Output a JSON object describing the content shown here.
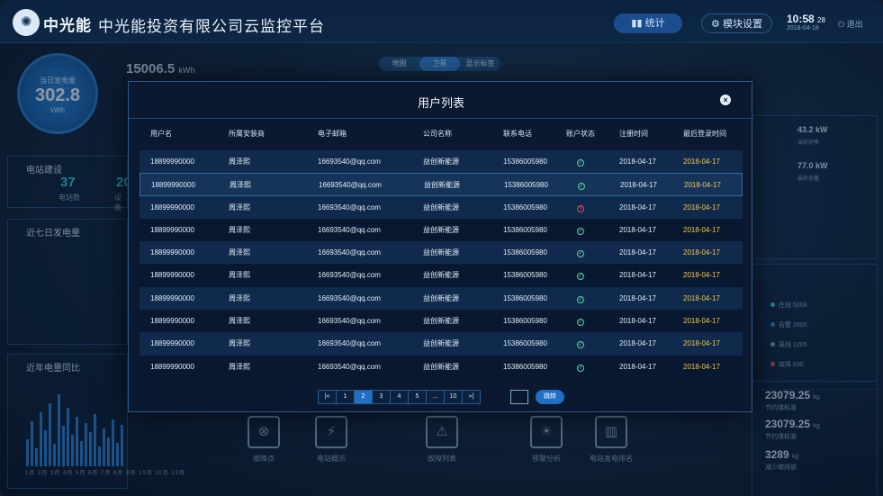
{
  "header": {
    "brand": "中光能",
    "company": "中光能投资有限公司云监控平台",
    "stats_label": "统计",
    "modules_label": "模块设置",
    "time": "10:58",
    "seconds": "28",
    "date": "2018-04-18",
    "logout_label": "退出"
  },
  "background": {
    "gauge_title": "当日发电量",
    "gauge_value": "302.8",
    "gauge_unit": "kWh",
    "total_kwh": "15006.5",
    "total_unit": "kWh",
    "station_title": "电站建设",
    "station_count": "37",
    "station_count_label": "电站数",
    "device_count": "20",
    "device_label": "设备",
    "week_title": "近七日发电量",
    "year_title": "近年电量同比",
    "months": "1月 2月 3月 4月 5月 6月 7月 8月 9月 10月 11月 12月",
    "map_tabs": [
      "地图",
      "卫星",
      "显示标签"
    ],
    "right_power": "43.2",
    "right_power_unit": "kW",
    "right_power_label": "当前功率",
    "right_capacity": "77.0",
    "right_capacity_unit": "kW",
    "right_capacity_label": "装机容量",
    "legend": [
      {
        "label": "在线",
        "value": "5008",
        "color": "#3ad0e0"
      },
      {
        "label": "告警",
        "value": "2600",
        "color": "#2a86d8"
      },
      {
        "label": "离线",
        "value": "1205",
        "color": "#7fa3c8"
      },
      {
        "label": "故障",
        "value": "630",
        "color": "#e2504f"
      }
    ],
    "saving1": "23079.25",
    "saving1_unit": "kg",
    "saving1_label": "节约煤标准",
    "saving2": "23079.25",
    "saving2_unit": "kg",
    "saving2_label": "节约煤标准",
    "saving3": "3289",
    "saving3_unit": "kg",
    "saving3_label": "减少碳排放",
    "tiles": [
      "故障点",
      "电站概示",
      "故障列表",
      "预警分析",
      "电站发电排名"
    ]
  },
  "modal": {
    "title": "用户列表",
    "close_symbol": "×",
    "columns": [
      "用户名",
      "所属安装商",
      "电子邮箱",
      "公司名称",
      "联系电话",
      "账户状态",
      "注册时间",
      "最后登录时间"
    ],
    "rows": [
      {
        "username": "18899990000",
        "installer": "周泽熙",
        "email": "16693540@qq.com",
        "company": "益创新能源",
        "phone": "15386005980",
        "status": "ok",
        "registered": "2018-04-17",
        "last_login": "2018-04-17"
      },
      {
        "username": "18899990000",
        "installer": "周泽熙",
        "email": "16693540@qq.com",
        "company": "益创新能源",
        "phone": "15386005980",
        "status": "ok",
        "registered": "2018-04-17",
        "last_login": "2018-04-17"
      },
      {
        "username": "18899990000",
        "installer": "周泽熙",
        "email": "16693540@qq.com",
        "company": "益创新能源",
        "phone": "15386005980",
        "status": "disabled",
        "registered": "2018-04-17",
        "last_login": "2018-04-17"
      },
      {
        "username": "18899990000",
        "installer": "周泽熙",
        "email": "16693540@qq.com",
        "company": "益创新能源",
        "phone": "15386005980",
        "status": "ok",
        "registered": "2018-04-17",
        "last_login": "2018-04-17"
      },
      {
        "username": "18899990000",
        "installer": "周泽熙",
        "email": "16693540@qq.com",
        "company": "益创新能源",
        "phone": "15386005980",
        "status": "ok",
        "registered": "2018-04-17",
        "last_login": "2018-04-17"
      },
      {
        "username": "18899990000",
        "installer": "周泽熙",
        "email": "16693540@qq.com",
        "company": "益创新能源",
        "phone": "15386005980",
        "status": "ok",
        "registered": "2018-04-17",
        "last_login": "2018-04-17"
      },
      {
        "username": "18899990000",
        "installer": "周泽熙",
        "email": "16693540@qq.com",
        "company": "益创新能源",
        "phone": "15386005980",
        "status": "ok",
        "registered": "2018-04-17",
        "last_login": "2018-04-17"
      },
      {
        "username": "18899990000",
        "installer": "周泽熙",
        "email": "16693540@qq.com",
        "company": "益创新能源",
        "phone": "15386005980",
        "status": "ok",
        "registered": "2018-04-17",
        "last_login": "2018-04-17"
      },
      {
        "username": "18899990000",
        "installer": "周泽熙",
        "email": "16693540@qq.com",
        "company": "益创新能源",
        "phone": "15386005980",
        "status": "ok",
        "registered": "2018-04-17",
        "last_login": "2018-04-17"
      },
      {
        "username": "18899990000",
        "installer": "周泽熙",
        "email": "16693540@qq.com",
        "company": "益创新能源",
        "phone": "15386005980",
        "status": "ok",
        "registered": "2018-04-17",
        "last_login": "2018-04-17"
      }
    ],
    "selected_row": 1,
    "pager": {
      "first": "|«",
      "pages": [
        "1",
        "2",
        "3",
        "4",
        "5",
        "...",
        "10"
      ],
      "last": "»|",
      "current": "2",
      "go_label": "跳转"
    }
  }
}
